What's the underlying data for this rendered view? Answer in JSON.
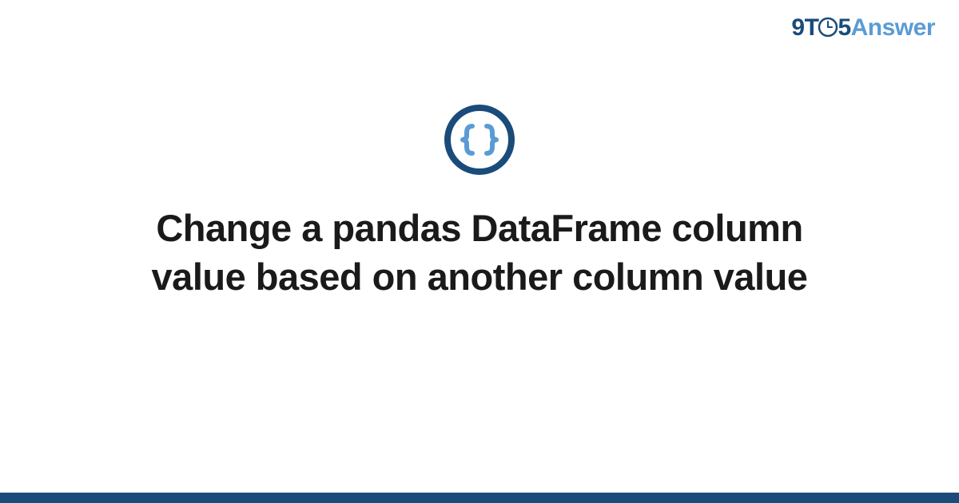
{
  "logo": {
    "prefix": "9T",
    "suffix": "5",
    "answer": "Answer"
  },
  "title": "Change a pandas DataFrame column value based on another column value",
  "colors": {
    "dark_blue": "#1a4b7a",
    "light_blue": "#5a9bd5",
    "text": "#1a1a1a"
  }
}
